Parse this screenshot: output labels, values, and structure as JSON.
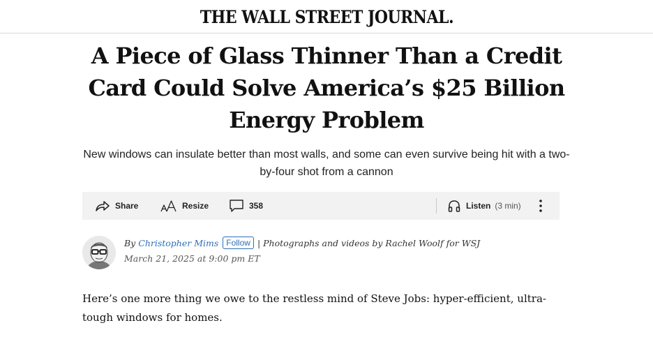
{
  "masthead": {
    "logo_text": "THE WALL STREET JOURNAL."
  },
  "article": {
    "headline": "A Piece of Glass Thinner Than a Credit Card Could Solve America’s $25 Billion Energy Problem",
    "dek": "New windows can insulate better than most walls, and some can even survive being hit with a two-by-four shot from a cannon",
    "body_first_paragraph": "Here’s one more thing we owe to the restless mind of Steve Jobs: hyper-efficient, ultra-tough windows for homes."
  },
  "toolbar": {
    "share_label": "Share",
    "resize_label": "Resize",
    "comments_count": "358",
    "listen_label": "Listen",
    "listen_duration": "(3 min)",
    "icons": [
      "share-icon",
      "resize-icon",
      "comment-icon",
      "headphones-icon",
      "more-vertical-icon"
    ]
  },
  "byline": {
    "prefix": "By",
    "author": "Christopher Mims",
    "follow_label": "Follow",
    "credit": "| Photographs and videos by Rachel Woolf for WSJ",
    "date": "March 21, 2025 at 9:00 pm ET"
  },
  "colors": {
    "link": "#2d6fb7",
    "toolbar_background": "#f2f2f2",
    "text": "#111111"
  }
}
